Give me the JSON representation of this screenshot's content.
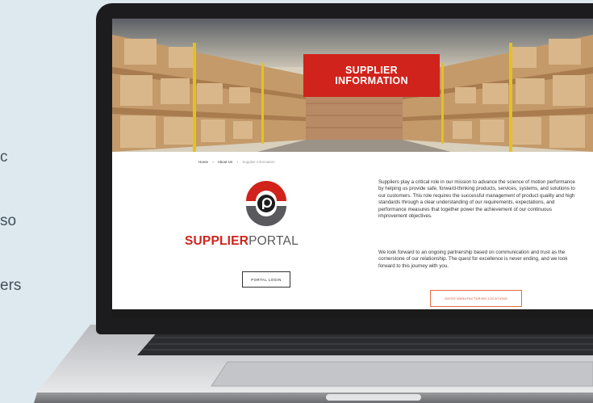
{
  "side_text": [
    "c",
    "so",
    "ers"
  ],
  "hero": {
    "title_line1": "SUPPLIER",
    "title_line2": "INFORMATION"
  },
  "breadcrumb": {
    "home": "Home",
    "sep1": "›",
    "about": "About Us",
    "sep2": "›",
    "current": "Supplier Information"
  },
  "logo": {
    "text_bold": "SUPPLIER",
    "text_light": "PORTAL"
  },
  "buttons": {
    "portal_login": "PORTAL LOGIN",
    "locations": "GATES MANUFACTURING LOCATIONS"
  },
  "content": {
    "para1": "Suppliers play a critical role in our mission to advance the science of motion performance by helping us provide safe, forward-thinking products, services, systems, and solutions to our customers. This role requires the successful management of product quality and high standards through a clear understanding of our requirements, expectations, and performance measures that together power the achievement of our continuous improvement objectives.",
    "para2": "We look forward to an ongoing partnership based on communication and trust as the cornerstone of our relationship. The quest for excellence is never ending, and we look forward to this journey with you."
  },
  "colors": {
    "brand_red": "#d0231b",
    "accent_orange": "#e26b42",
    "background": "#dde9ee"
  },
  "icons": [
    "supplier-portal-logo-icon"
  ]
}
